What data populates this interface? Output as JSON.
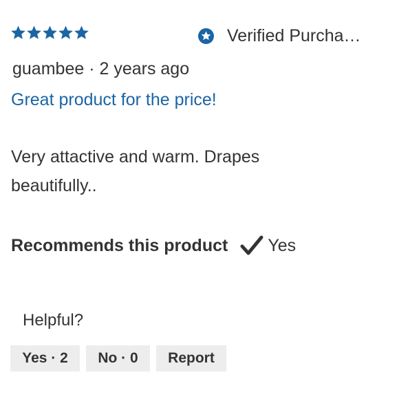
{
  "review": {
    "rating": 5,
    "rating_max": 5,
    "verified_label": "Verified Purcha…",
    "author": "guambee",
    "separator": " · ",
    "time_ago": "2 years ago",
    "title": "Great product for the price!",
    "body": "Very attactive and warm. Drapes beautifully..",
    "recommends_label": "Recommends this product",
    "recommends_value": "Yes"
  },
  "helpful": {
    "label": "Helpful?",
    "yes_label": "Yes · 2",
    "no_label": "No · 0",
    "report_label": "Report"
  },
  "icons": {
    "star": "star-icon",
    "verified": "verified-badge-icon",
    "check": "checkmark-icon"
  },
  "colors": {
    "accent": "#1b65a4",
    "text": "#333333",
    "button_bg": "#ededed"
  }
}
